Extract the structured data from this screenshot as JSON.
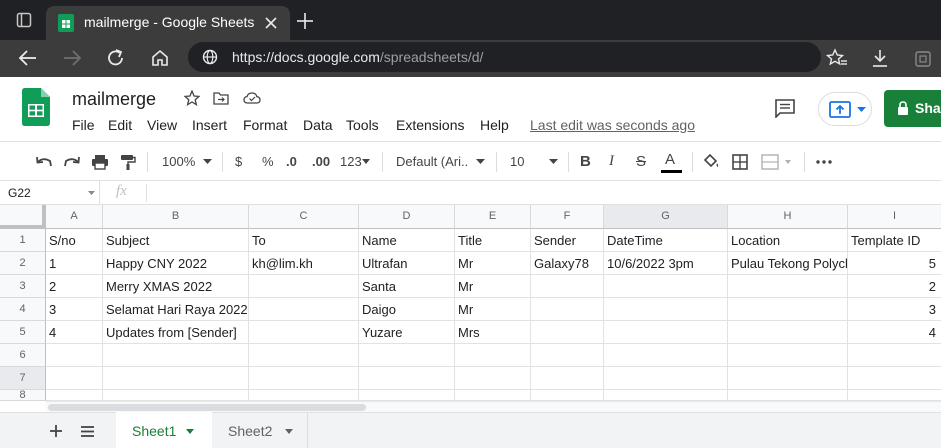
{
  "browser": {
    "tab_title": "mailmerge - Google Sheets",
    "url_host": "https://docs.google.com",
    "url_path": "/spreadsheets/d/"
  },
  "app": {
    "doc_title": "mailmerge",
    "menu": [
      "File",
      "Edit",
      "View",
      "Insert",
      "Format",
      "Data",
      "Tools",
      "Extensions",
      "Help"
    ],
    "last_edit": "Last edit was seconds ago",
    "share_label": "Sha"
  },
  "toolbar": {
    "zoom": "100%",
    "currency": "$",
    "percent": "%",
    "dec_decrease": ".0",
    "dec_increase": ".00",
    "format_more": "123",
    "font": "Default (Ari...",
    "font_size": "10",
    "bold": "B",
    "italic": "I",
    "strike": "S",
    "text_color": "A"
  },
  "formula_bar": {
    "name_box": "G22",
    "fx": "fx"
  },
  "grid": {
    "columns": [
      "A",
      "B",
      "C",
      "D",
      "E",
      "F",
      "G",
      "H",
      "I"
    ],
    "row_numbers": [
      "1",
      "2",
      "3",
      "4",
      "5",
      "6",
      "7",
      "8"
    ],
    "rows": [
      [
        "S/no",
        "Subject",
        "To",
        "Name",
        "Title",
        "Sender",
        "DateTime",
        "Location",
        "Template ID"
      ],
      [
        "1",
        "Happy CNY 2022",
        "kh@lim.kh",
        "Ultrafan",
        "Mr",
        "Galaxy78",
        "10/6/2022 3pm",
        "Pulau Tekong Polyclinic",
        "5"
      ],
      [
        "2",
        "Merry XMAS 2022",
        "",
        "Santa",
        "Mr",
        "",
        "",
        "",
        "2"
      ],
      [
        "3",
        "Selamat Hari Raya 2022",
        "",
        "Daigo",
        "Mr",
        "",
        "",
        "",
        "3"
      ],
      [
        "4",
        "Updates from [Sender]",
        "",
        "Yuzare",
        "Mrs",
        "",
        "",
        "",
        "4"
      ],
      [
        "",
        "",
        "",
        "",
        "",
        "",
        "",
        "",
        ""
      ],
      [
        "",
        "",
        "",
        "",
        "",
        "",
        "",
        "",
        ""
      ],
      [
        "",
        "",
        "",
        "",
        "",
        "",
        "",
        "",
        ""
      ]
    ]
  },
  "sheets": {
    "tabs": [
      "Sheet1",
      "Sheet2"
    ],
    "active": "Sheet1"
  },
  "colors": {
    "share_green": "#188038",
    "sheet_active": "#188038",
    "chrome_dark": "#202124",
    "chrome_toolbar": "#3c3c3c"
  }
}
